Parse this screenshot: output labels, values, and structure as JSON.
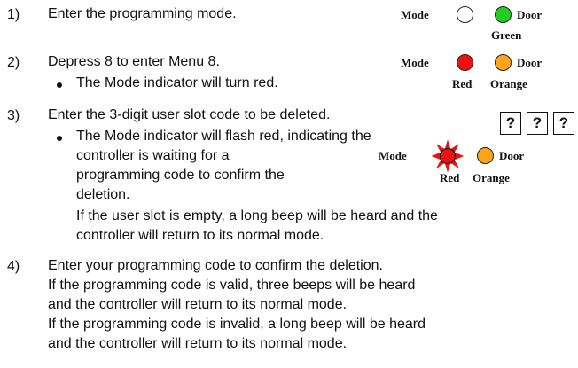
{
  "steps": [
    {
      "number": "1)",
      "text": "Enter the programming mode."
    },
    {
      "number": "2)",
      "text": "Depress 8 to enter Menu 8.",
      "bullet": "The Mode indicator will turn red."
    },
    {
      "number": "3)",
      "text": "Enter the 3-digit user slot code to be deleted.",
      "bullet_lines": [
        "The Mode indicator will flash red, indicating the",
        "controller is waiting for a",
        "programming code to confirm the",
        "deletion."
      ],
      "note_lines": [
        "If the user slot is empty, a long beep will be heard and the",
        "controller will return to its normal mode."
      ]
    },
    {
      "number": "4)",
      "lines": [
        "Enter your programming code to confirm the deletion.",
        "If the programming code is valid, three beeps will be heard",
        "and the controller will return to its normal mode.",
        "If the programming code is invalid, a long beep will be heard",
        "and the controller will return to its normal mode."
      ]
    }
  ],
  "indicators": [
    {
      "mode_label": "Mode",
      "door_label": "Door",
      "mode_color": "#ffffff",
      "door_color": "#22cc22",
      "mode_caption": "",
      "door_caption": "Green"
    },
    {
      "mode_label": "Mode",
      "door_label": "Door",
      "mode_color": "#ee1111",
      "door_color": "#ffa31a",
      "mode_caption": "Red",
      "door_caption": "Orange"
    },
    {
      "mode_label": "Mode",
      "door_label": "Door",
      "mode_color": "#ee1111",
      "door_color": "#ffa31a",
      "mode_caption": "Red",
      "door_caption": "Orange",
      "mode_state": "flashing"
    }
  ],
  "code_boxes": [
    "?",
    "?",
    "?"
  ]
}
